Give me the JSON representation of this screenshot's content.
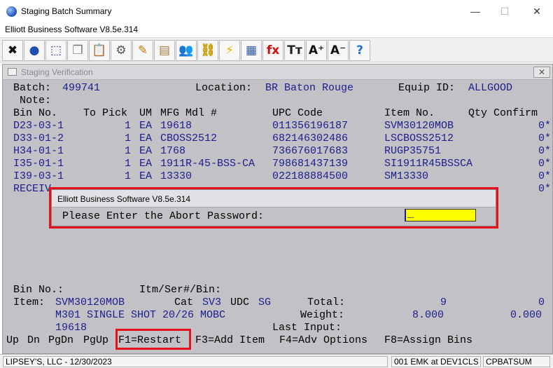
{
  "window": {
    "title": "Staging Batch Summary",
    "subtitle": "Elliott Business Software V8.5e.314"
  },
  "toolbar": {
    "buttons": [
      {
        "name": "close-icon",
        "glyph": "✖",
        "color": "#111111"
      },
      {
        "name": "globe-icon",
        "glyph": "●",
        "color": "#1f4fb5"
      },
      {
        "name": "select-icon",
        "glyph": "⬚",
        "color": "#1f3aa8"
      },
      {
        "name": "copy-icon",
        "glyph": "❐",
        "color": "#777777"
      },
      {
        "name": "paste-icon",
        "glyph": "📋",
        "color": "#b07a2a"
      },
      {
        "name": "gear-icon",
        "glyph": "⚙",
        "color": "#555555"
      },
      {
        "name": "edit-icon",
        "glyph": "✎",
        "color": "#cc7700"
      },
      {
        "name": "notepad-icon",
        "glyph": "▤",
        "color": "#a07a3a"
      },
      {
        "name": "users-icon",
        "glyph": "👥",
        "color": "#2a7a2a"
      },
      {
        "name": "chain-icon",
        "glyph": "⛓",
        "color": "#c79a00"
      },
      {
        "name": "lightning-icon",
        "glyph": "⚡",
        "color": "#e0b800"
      },
      {
        "name": "report-icon",
        "glyph": "▦",
        "color": "#3355aa"
      },
      {
        "name": "function-icon",
        "glyph": "fx",
        "color": "#d01010"
      },
      {
        "name": "font-icon",
        "glyph": "Tт",
        "color": "#222222"
      },
      {
        "name": "font-increase-icon",
        "glyph": "A⁺",
        "color": "#111111"
      },
      {
        "name": "font-decrease-icon",
        "glyph": "A⁻",
        "color": "#111111"
      },
      {
        "name": "help-icon",
        "glyph": "?",
        "color": "#1d6fd8"
      }
    ]
  },
  "inner": {
    "title": "Staging Verification",
    "close": "✕",
    "batch_label": "Batch:",
    "batch_value": "499741",
    "location_label": "Location:",
    "location_value": "BR Baton Rouge",
    "equip_label": "Equip ID:",
    "equip_value": "ALLGOOD",
    "note_label": "Note:",
    "headers": [
      "Bin No.",
      "To Pick",
      "UM",
      "MFG Mdl #",
      "UPC Code",
      "Item No.",
      "Qty Confirm"
    ],
    "rows": [
      {
        "bin": "D23-03-1",
        "pick": "1",
        "um": "EA",
        "mdl": "19618",
        "upc": "011356196187",
        "item": "SVM30120MOB",
        "qty": "0*"
      },
      {
        "bin": "D33-01-2",
        "pick": "1",
        "um": "EA",
        "mdl": "CBOSS2512",
        "upc": "682146302486",
        "item": "LSCBOSS2512",
        "qty": "0*"
      },
      {
        "bin": "H34-01-1",
        "pick": "1",
        "um": "EA",
        "mdl": "1768",
        "upc": "736676017683",
        "item": "RUGP35751",
        "qty": "0*"
      },
      {
        "bin": "I35-01-1",
        "pick": "1",
        "um": "EA",
        "mdl": "1911R-45-BSS-CA",
        "upc": "798681437139",
        "item": "SI1911R45BSSCA",
        "qty": "0*"
      },
      {
        "bin": "I39-03-1",
        "pick": "1",
        "um": "EA",
        "mdl": "13330",
        "upc": "022188884500",
        "item": "SM13330",
        "qty": "0*"
      },
      {
        "bin": "RECEIV",
        "pick": "",
        "um": "",
        "mdl": "",
        "upc": "",
        "item": "",
        "qty": "0*"
      }
    ],
    "bin_no_label": "Bin No.:",
    "itm_ser_label": "Itm/Ser#/Bin:",
    "item_label": "Item:",
    "item_value": "SVM30120MOB",
    "cat_label": "Cat",
    "cat_value": "SV3",
    "udc_label": "UDC",
    "udc_value": "SG",
    "total_label": "Total:",
    "total_value": "9",
    "total_confirm": "0",
    "desc_value": "M301 SINGLE SHOT 20/26 MOBC",
    "weight_label": "Weight:",
    "weight_value": "8.000",
    "weight_confirm": "0.000",
    "mdl_value": "19618",
    "last_input_label": "Last Input:"
  },
  "dialog": {
    "title": "Elliott Business Software V8.5e.314",
    "prompt": "Please Enter the Abort Password:",
    "input_value": "_"
  },
  "fkeys": {
    "up": "Up",
    "dn": "Dn",
    "pgdn": "PgDn",
    "pgup": "PgUp",
    "f1": "F1=Restart",
    "f3": "F3=Add Item",
    "f4": "F4=Adv Options",
    "f8": "F8=Assign Bins"
  },
  "statusbar": {
    "company": "LIPSEY'S, LLC - 12/30/2023",
    "session": "001 EMK at DEV1CLS",
    "program": "CPBATSUM"
  }
}
